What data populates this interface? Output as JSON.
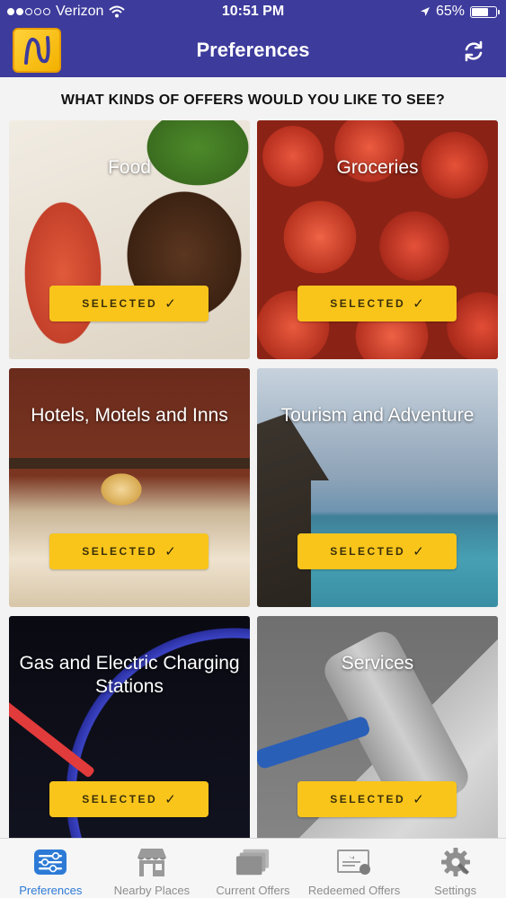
{
  "status_bar": {
    "carrier": "Verizon",
    "time": "10:51 PM",
    "battery": "65%",
    "signal_bars": 2,
    "battery_level": 0.65
  },
  "header": {
    "title": "Preferences",
    "logo_letter": "N"
  },
  "question": "WHAT KINDS OF OFFERS WOULD YOU LIKE TO SEE?",
  "select_label": "SELECTED",
  "check_glyph": "✓",
  "categories": [
    {
      "label": "Food"
    },
    {
      "label": "Groceries"
    },
    {
      "label": "Hotels, Motels and Inns"
    },
    {
      "label": "Tourism and Adventure"
    },
    {
      "label": "Gas and Electric Charging Stations"
    },
    {
      "label": "Services"
    }
  ],
  "tabs": [
    {
      "label": "Preferences",
      "icon": "sliders-icon",
      "active": true
    },
    {
      "label": "Nearby Places",
      "icon": "store-icon",
      "active": false
    },
    {
      "label": "Current Offers",
      "icon": "cards-icon",
      "active": false
    },
    {
      "label": "Redeemed Offers",
      "icon": "certificate-icon",
      "active": false
    },
    {
      "label": "Settings",
      "icon": "gear-icon",
      "active": false
    }
  ],
  "colors": {
    "brand": "#3d3b9c",
    "accent": "#f9c51b",
    "active_tab": "#2d7ad6"
  }
}
